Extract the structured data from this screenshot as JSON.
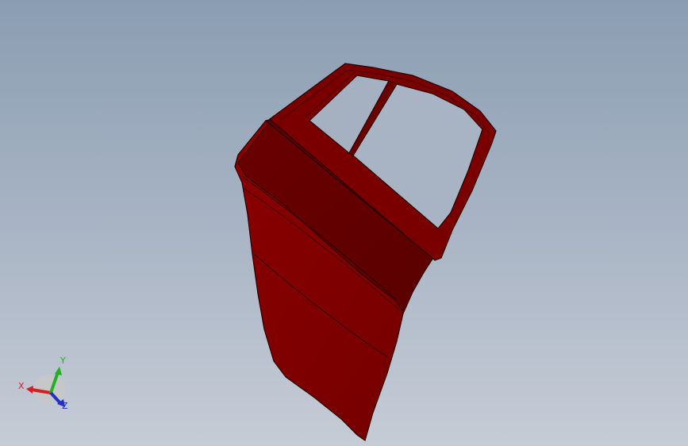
{
  "viewport": {
    "background_top": "#8a9db2",
    "background_bottom": "#c6ccd6"
  },
  "model": {
    "part": "car-door",
    "body_color": "#7d0000",
    "edge_color": "#2a0000"
  },
  "triad": {
    "x_label": "X",
    "y_label": "Y",
    "z_label": "Z",
    "x_color": "#d42020",
    "y_color": "#22b022",
    "z_color": "#2030c8"
  }
}
